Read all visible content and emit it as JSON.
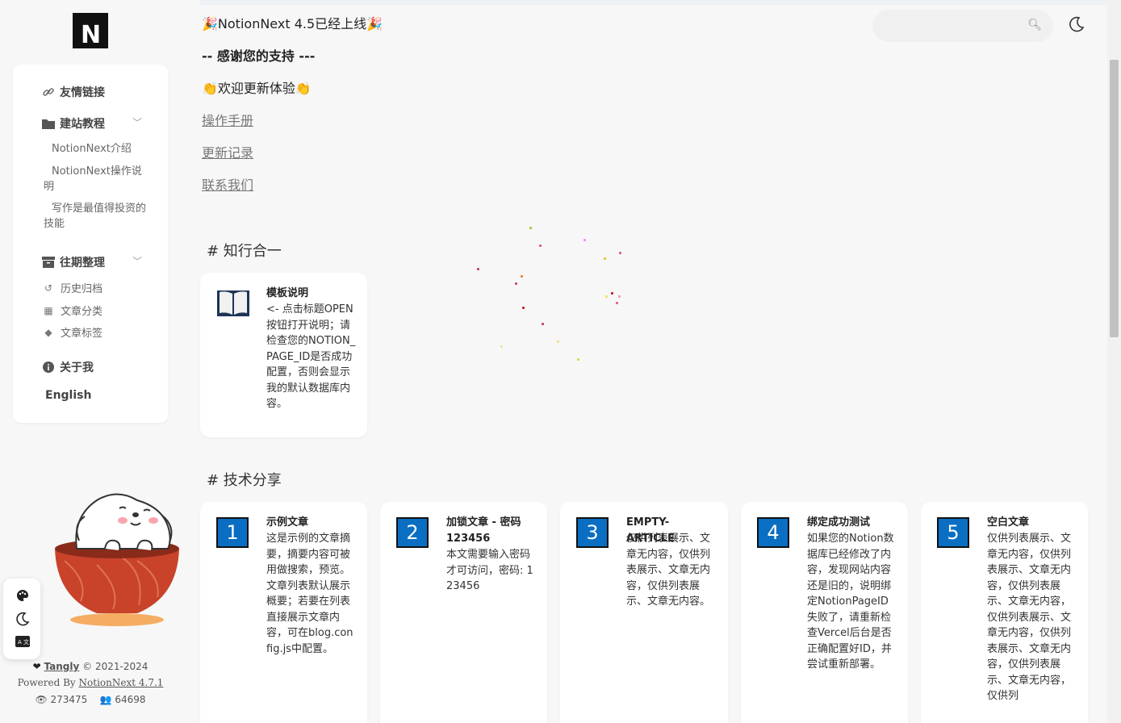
{
  "sidebar": {
    "menu": {
      "links": "友情链接",
      "tutorial": "建站教程",
      "tutorial_items": [
        "NotionNext介绍",
        "NotionNext操作说明",
        "写作是最值得投资的技能"
      ],
      "archive": "往期整理",
      "archive_items": [
        "历史归档",
        "文章分类",
        "文章标签"
      ],
      "about": "关于我",
      "language": "English"
    }
  },
  "footer": {
    "author": "Tangly",
    "copyright": "© 2021-2024",
    "powered_prefix": "Powered By",
    "powered_link": "NotionNext 4.7.1",
    "views": "273475",
    "visitors": "64698"
  },
  "notice": {
    "headline": "🎉NotionNext 4.5已经上线🎉",
    "thanks": "-- 感谢您的支持 ---",
    "welcome": "👏欢迎更新体验👏",
    "links": [
      "操作手册",
      "更新记录",
      "联系我们"
    ]
  },
  "sections": [
    {
      "heading": "# 知行合一",
      "cards": [
        {
          "icon": "📖",
          "title": "模板说明",
          "body": "<- 点击标题OPEN按钮打开说明；请检查您的NOTION_PAGE_ID是否成功配置，否则会显示我的默认数据库内容。"
        }
      ]
    },
    {
      "heading": "# 技术分享",
      "cards": [
        {
          "num": "1",
          "title": "示例文章",
          "body": "这是示例的文章摘要，摘要内容可被用做搜索，预览。文章列表默认展示概要；若要在列表直接展示文章内容，可在blog.config.js中配置。"
        },
        {
          "num": "2",
          "title": "加锁文章 - 密码 123456",
          "body": "本文需要输入密码才可访问，密码: 123456"
        },
        {
          "num": "3",
          "title": "EMPTY-ARTICLE",
          "body": "仅供列表展示、文章无内容，仅供列表展示、文章无内容，仅供列表展示、文章无内容。"
        },
        {
          "num": "4",
          "title": "绑定成功测试",
          "body": "如果您的Notion数据库已经修改了内容，发现网站内容还是旧的，说明绑定NotionPageID失败了，请重新检查Vercel后台是否正确配置好ID，并尝试重新部署。"
        },
        {
          "num": "5",
          "title": "空白文章",
          "body": "仅供列表展示、文章无内容，仅供列表展示、文章无内容，仅供列表展示、文章无内容，仅供列表展示、文章无内容，仅供列表展示、文章无内容，仅供列表展示、文章无内容，仅供列"
        }
      ]
    }
  ],
  "icons": [
    "link-icon",
    "folder-icon",
    "archive-icon",
    "history-icon",
    "grid-icon",
    "tag-icon",
    "info-icon",
    "search-icon",
    "moon-icon",
    "palette-icon",
    "translate-icon",
    "heart-icon",
    "eye-icon",
    "users-icon"
  ],
  "colors": {
    "accent_blue": "#0a6fc2"
  }
}
